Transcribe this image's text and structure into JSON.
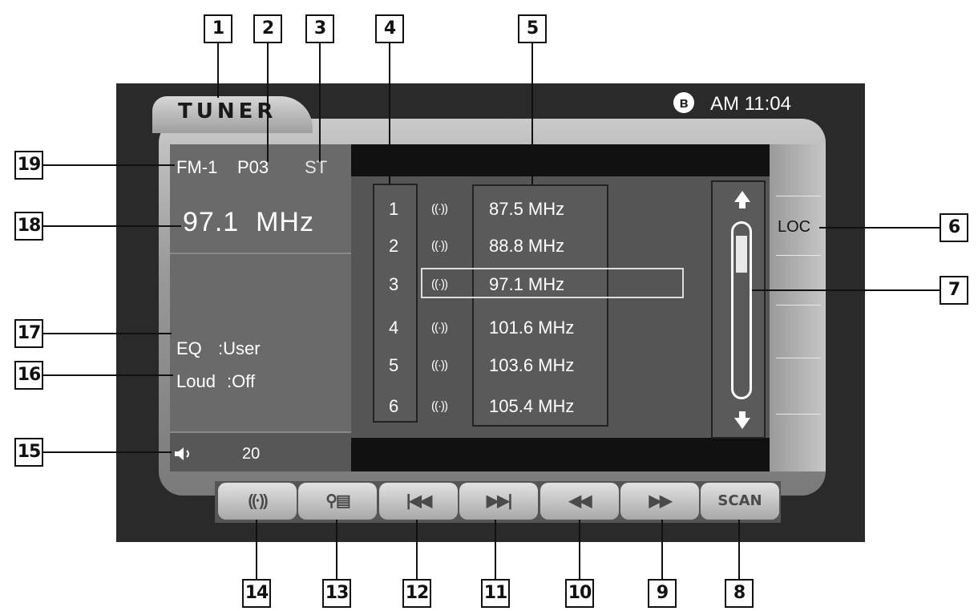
{
  "header": {
    "title": "TUNER",
    "clock": "AM 11:04"
  },
  "status": {
    "band": "FM-1",
    "preset": "P03",
    "stereo": "ST"
  },
  "frequency": "97.1  MHz",
  "settings": {
    "eq_label": "EQ",
    "eq_value": ":User",
    "loud_label": "Loud",
    "loud_value": ":Off"
  },
  "volume": "20",
  "presets": [
    {
      "num": "1",
      "freq": "87.5 MHz"
    },
    {
      "num": "2",
      "freq": "88.8 MHz"
    },
    {
      "num": "3",
      "freq": "97.1 MHz"
    },
    {
      "num": "4",
      "freq": "101.6 MHz"
    },
    {
      "num": "5",
      "freq": "103.6 MHz"
    },
    {
      "num": "6",
      "freq": "105.4 MHz"
    }
  ],
  "selected_preset_index": 3,
  "loc_label": "LOC",
  "scan_label": "SCAN",
  "callouts": [
    "1",
    "2",
    "3",
    "4",
    "5",
    "6",
    "7",
    "8",
    "9",
    "10",
    "11",
    "12",
    "13",
    "14",
    "15",
    "16",
    "17",
    "18",
    "19"
  ],
  "icons": {
    "bluetooth": "bluetooth-icon",
    "antenna": "antenna-icon",
    "speaker": "speaker-icon",
    "band": "band-icon",
    "search_save": "search-save-icon",
    "prev": "skip-previous-icon",
    "next": "skip-next-icon",
    "rewind": "seek-back-icon",
    "forward": "seek-forward-icon"
  },
  "colors": {
    "frame": "#2a2a2a",
    "bezel": "#9a9a9a",
    "panel": "#6a6a6a",
    "screen": "#111111"
  }
}
